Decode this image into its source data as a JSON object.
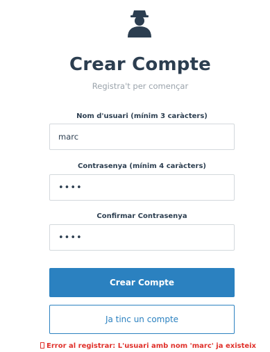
{
  "header": {
    "avatar_icon": "user-avatar-icon",
    "title": "Crear Compte",
    "subtitle": "Registra't per començar"
  },
  "form": {
    "username": {
      "label": "Nom d'usuari (mínim 3 caràcters)",
      "value": "marc"
    },
    "password": {
      "label": "Contrasenya (mínim 4 caràcters)",
      "value": "1234"
    },
    "confirm_password": {
      "label": "Confirmar Contrasenya",
      "value": "1234"
    },
    "submit_label": "Crear Compte",
    "login_label": "Ja tinc un compte"
  },
  "error": {
    "icon": "error-icon",
    "message": "Error al registrar: L'usuari amb nom 'marc' ja existeix"
  },
  "colors": {
    "primary": "#2b81c0",
    "title": "#2c3e50",
    "error": "#e0302a"
  }
}
